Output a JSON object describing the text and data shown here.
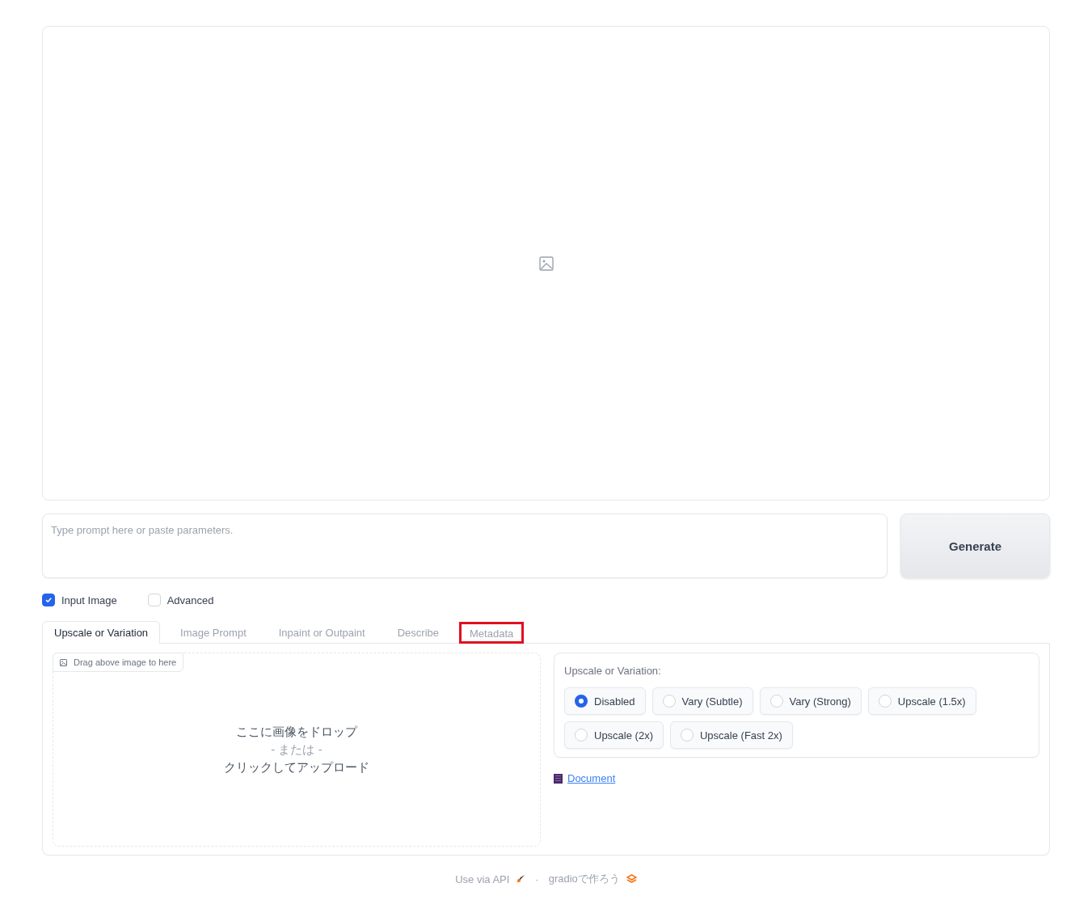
{
  "prompt": {
    "placeholder": "Type prompt here or paste parameters."
  },
  "generate_button": "Generate",
  "options": [
    {
      "label": "Input Image",
      "checked": true
    },
    {
      "label": "Advanced",
      "checked": false
    }
  ],
  "tabs": [
    {
      "label": "Upscale or Variation",
      "selected": true,
      "highlighted": false
    },
    {
      "label": "Image Prompt",
      "selected": false,
      "highlighted": false
    },
    {
      "label": "Inpaint or Outpaint",
      "selected": false,
      "highlighted": false
    },
    {
      "label": "Describe",
      "selected": false,
      "highlighted": false
    },
    {
      "label": "Metadata",
      "selected": false,
      "highlighted": true
    }
  ],
  "upload": {
    "badge": "Drag above image to here",
    "drop_text": "ここに画像をドロップ",
    "or_text": "- または -",
    "click_text": "クリックしてアップロード"
  },
  "radio_group": {
    "label": "Upscale or Variation:",
    "options": [
      {
        "label": "Disabled",
        "selected": true
      },
      {
        "label": "Vary (Subtle)",
        "selected": false
      },
      {
        "label": "Vary (Strong)",
        "selected": false
      },
      {
        "label": "Upscale (1.5x)",
        "selected": false
      },
      {
        "label": "Upscale (2x)",
        "selected": false
      },
      {
        "label": "Upscale (Fast 2x)",
        "selected": false
      }
    ]
  },
  "document_link": "Document",
  "footer": {
    "api_link": "Use via API",
    "separator": "·",
    "built_with": "gradioで作ろう"
  }
}
